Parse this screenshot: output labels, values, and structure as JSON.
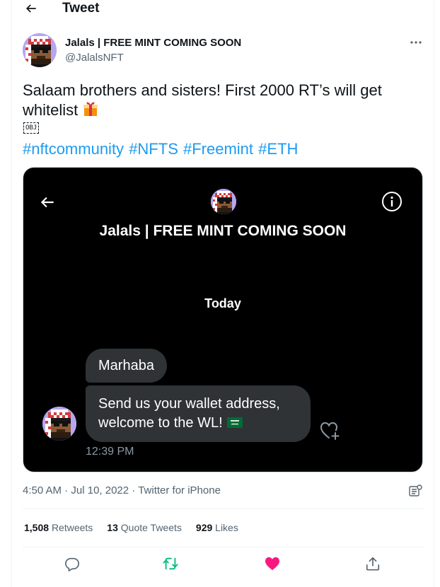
{
  "header": {
    "title": "Tweet",
    "back_icon": "arrow-left-icon"
  },
  "author": {
    "name": "Jalals | FREE MINT COMING SOON",
    "handle": "@JalalsNFT",
    "avatar": "pixel-art-avatar",
    "more_icon": "more-horizontal-icon"
  },
  "tweet": {
    "line1": "Salaam brothers and sisters! First 2000 RT’s will get",
    "line2": "whitelist",
    "obj_label": "OBJ",
    "hashtags": [
      "#nftcommunity",
      "#NFTS",
      "#Freemint",
      "#ETH"
    ]
  },
  "media": {
    "title": "Jalals | FREE MINT COMING SOON",
    "day_label": "Today",
    "message1": "Marhaba",
    "message2_line1": "Send us your wallet address,",
    "message2_line2": "welcome to the WL!",
    "time": "12:39 PM",
    "info_icon": "info-icon",
    "react_icon": "heart-plus-icon"
  },
  "meta": {
    "time": "4:50 AM",
    "sep1": " · ",
    "date": "Jul 10, 2022",
    "sep2": " · ",
    "source": "Twitter for iPhone",
    "analytics_icon": "analytics-icon"
  },
  "stats": {
    "retweets_count": "1,508",
    "retweets_label": "Retweets",
    "quotes_count": "13",
    "quotes_label": "Quote Tweets",
    "likes_count": "929",
    "likes_label": "Likes"
  },
  "actions": {
    "reply_icon": "reply-icon",
    "retweet_icon": "retweet-icon",
    "like_icon": "heart-icon",
    "share_icon": "share-icon",
    "colors": {
      "retweet": "#00ba7c",
      "like": "#f91880",
      "default": "#536471"
    }
  },
  "colors": {
    "link": "#1d9bf0",
    "secondary": "#536471",
    "media_bg": "#000000",
    "bubble": "#2f3336"
  }
}
